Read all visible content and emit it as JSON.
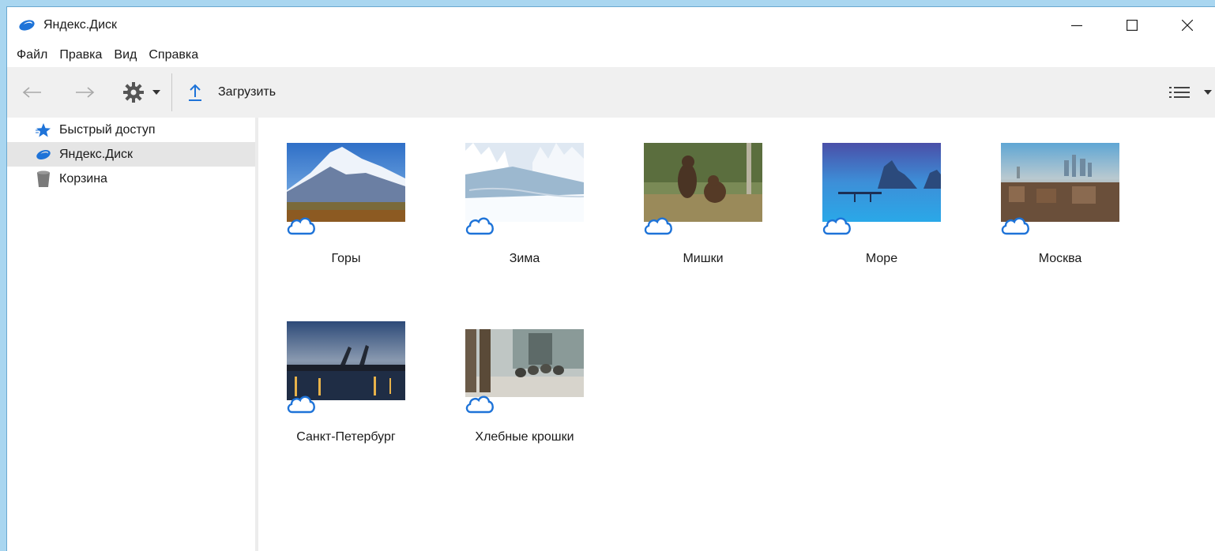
{
  "window": {
    "title": "Яндекс.Диск",
    "controls": {
      "minimize": "minimize-icon",
      "maximize": "maximize-icon",
      "close": "close-icon"
    }
  },
  "menu": {
    "items": [
      {
        "label": "Файл"
      },
      {
        "label": "Правка"
      },
      {
        "label": "Вид"
      },
      {
        "label": "Справка"
      }
    ]
  },
  "toolbar": {
    "upload_label": "Загрузить",
    "icons": {
      "back": "arrow-left-icon",
      "forward": "arrow-right-icon",
      "settings": "gear-icon",
      "upload": "upload-arrow-icon",
      "view": "list-view-icon"
    }
  },
  "sidebar": {
    "items": [
      {
        "label": "Быстрый доступ",
        "icon": "star-icon",
        "selected": false
      },
      {
        "label": "Яндекс.Диск",
        "icon": "yandex-disk-icon",
        "selected": true
      },
      {
        "label": "Корзина",
        "icon": "trash-icon",
        "selected": false
      }
    ]
  },
  "folders": [
    {
      "name": "Горы",
      "thumb": "mountains",
      "status_icon": "cloud-icon"
    },
    {
      "name": "Зима",
      "thumb": "winter",
      "status_icon": "cloud-icon"
    },
    {
      "name": "Мишки",
      "thumb": "bears",
      "status_icon": "cloud-icon"
    },
    {
      "name": "Море",
      "thumb": "sea",
      "status_icon": "cloud-icon"
    },
    {
      "name": "Москва",
      "thumb": "moscow",
      "status_icon": "cloud-icon"
    },
    {
      "name": "Санкт-Петербург",
      "thumb": "spb",
      "status_icon": "cloud-icon"
    },
    {
      "name": "Хлебные крошки",
      "thumb": "breadcrumbs",
      "status_icon": "cloud-icon"
    }
  ],
  "colors": {
    "accent": "#1e73d8",
    "selection": "#e5e5e5",
    "toolbar_bg": "#f0f0f0",
    "desktop_bg": "#a9d6f0"
  }
}
